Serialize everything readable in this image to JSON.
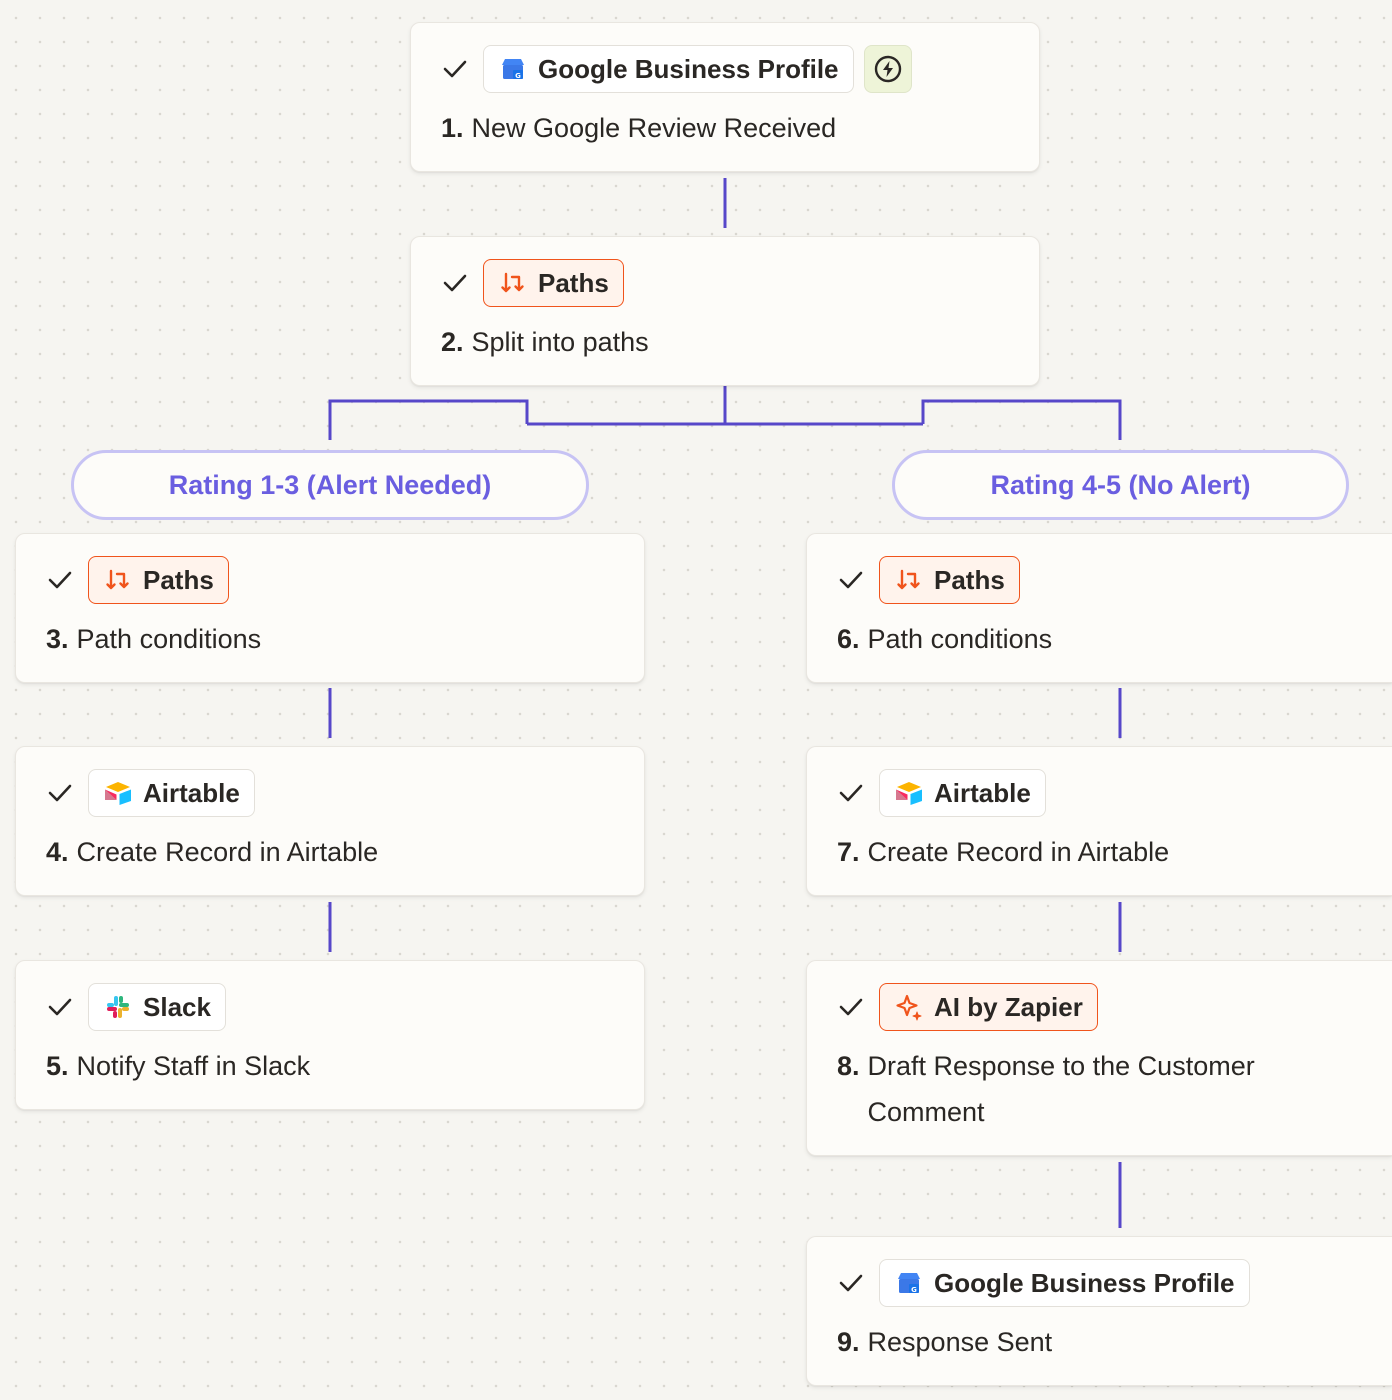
{
  "steps": [
    {
      "app": "Google Business Profile",
      "num": "1.",
      "title": "New Google Review Received"
    },
    {
      "app": "Paths",
      "num": "2.",
      "title": "Split into paths"
    },
    {
      "app": "Paths",
      "num": "3.",
      "title": "Path conditions"
    },
    {
      "app": "Airtable",
      "num": "4.",
      "title": "Create Record in Airtable"
    },
    {
      "app": "Slack",
      "num": "5.",
      "title": "Notify Staff in Slack"
    },
    {
      "app": "Paths",
      "num": "6.",
      "title": "Path conditions"
    },
    {
      "app": "Airtable",
      "num": "7.",
      "title": "Create Record in Airtable"
    },
    {
      "app": "AI by Zapier",
      "num": "8.",
      "title": "Draft Response to the Customer Comment"
    },
    {
      "app": "Google Business Profile",
      "num": "9.",
      "title": "Response Sent"
    }
  ],
  "branches": {
    "left": "Rating 1-3 (Alert Needed)",
    "right": "Rating 4-5 (No Alert)"
  },
  "icons": {
    "check": "check-icon",
    "trigger": "lightning-bolt-icon",
    "google": "google-business-profile-icon",
    "paths": "paths-icon",
    "airtable": "airtable-icon",
    "slack": "slack-icon",
    "ai": "ai-sparkle-icon"
  },
  "colors": {
    "connector": "#5747c9",
    "branch_text": "#6a5ee0",
    "branch_border": "#c7c3f4",
    "paths_accent": "#f0541c",
    "trigger_bg": "#eef4d8"
  }
}
